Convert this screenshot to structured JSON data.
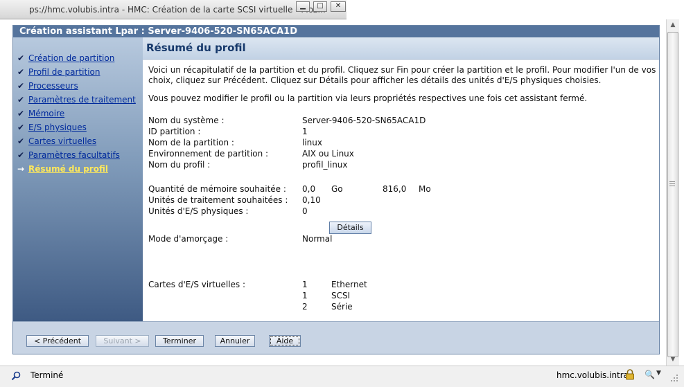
{
  "browser": {
    "window_title": "ps://hmc.volubis.intra - HMC: Création de la carte SCSI virtuelle - Moz...",
    "status_text": "Terminé",
    "host": "hmc.volubis.intra"
  },
  "wizard": {
    "header_title": "Création assistant Lpar : Server-9406-520-SN65ACA1D",
    "nav": [
      {
        "label": "Création de partition",
        "state": "done"
      },
      {
        "label": "Profil de partition",
        "state": "done"
      },
      {
        "label": "Processeurs",
        "state": "done"
      },
      {
        "label": "Paramètres de traitement",
        "state": "done"
      },
      {
        "label": "Mémoire",
        "state": "done"
      },
      {
        "label": "E/S physiques",
        "state": "done"
      },
      {
        "label": "Cartes virtuelles",
        "state": "done"
      },
      {
        "label": "Paramètres facultatifs",
        "state": "done"
      },
      {
        "label": "Résumé du profil",
        "state": "current"
      }
    ],
    "content": {
      "title": "Résumé du profil",
      "intro": "Voici un récapitulatif de la partition et du profil. Cliquez sur Fin pour créer la partition et le profil. Pour modifier l'un de vos choix, cliquez sur Précédent. Cliquez sur Détails pour afficher les détails des unités d'E/S physiques choisies.",
      "note": "Vous pouvez modifier le profil ou la partition via leurs propriétés respectives une fois cet assistant fermé.",
      "fields": {
        "system_name": {
          "label": "Nom du système :",
          "value": "Server-9406-520-SN65ACA1D"
        },
        "partition_id": {
          "label": "ID partition :",
          "value": "1"
        },
        "partition_name": {
          "label": "Nom de la partition :",
          "value": "linux"
        },
        "partition_env": {
          "label": "Environnement de partition :",
          "value": "AIX ou Linux"
        },
        "profile_name": {
          "label": "Nom du profil :",
          "value": "profil_linux"
        },
        "memory": {
          "label": "Quantité de mémoire souhaitée :",
          "gb_value": "0,0",
          "gb_unit": "Go",
          "mb_value": "816,0",
          "mb_unit": "Mo"
        },
        "proc_units": {
          "label": "Unités de traitement souhaitées :",
          "value": "0,10"
        },
        "io_units": {
          "label": "Unités d'E/S physiques :",
          "value": "0"
        },
        "boot_mode": {
          "label": "Mode d'amorçage :",
          "value": "Normal"
        },
        "virtual_adapters_label": "Cartes d'E/S virtuelles :"
      },
      "details_button": "Détails",
      "virtual_adapters": [
        {
          "count": "1",
          "type": "Ethernet"
        },
        {
          "count": "1",
          "type": "SCSI"
        },
        {
          "count": "2",
          "type": "Série"
        }
      ]
    },
    "footer": {
      "previous": "< Précédent",
      "next": "Suivant >",
      "finish": "Terminer",
      "cancel": "Annuler",
      "help": "Aide"
    }
  }
}
